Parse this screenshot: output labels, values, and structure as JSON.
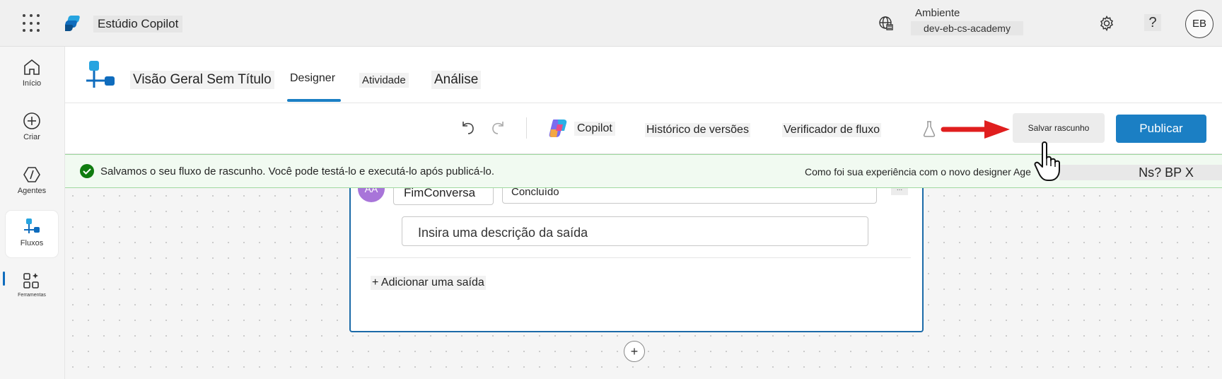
{
  "topbar": {
    "app_name": "Estúdio Copilot",
    "environment_label": "Ambiente",
    "environment_value": "dev-eb-cs-academy",
    "help_label": "?",
    "avatar_initials": "EB"
  },
  "rail": {
    "items": [
      {
        "label": "Início",
        "icon": "home-icon"
      },
      {
        "label": "Criar",
        "icon": "add-circle-icon"
      },
      {
        "label": "Agentes",
        "icon": "agents-icon"
      },
      {
        "label": "Fluxos",
        "icon": "flows-icon",
        "active": true
      },
      {
        "label": "Ferramentas",
        "icon": "tools-icon"
      }
    ],
    "more_label": "..."
  },
  "header": {
    "flow_title": "Visão Geral Sem Título",
    "tabs": [
      {
        "label": "Designer",
        "active": true
      },
      {
        "label": "Atividade"
      },
      {
        "label": "Análise"
      }
    ]
  },
  "toolbar": {
    "copilot_label": "Copilot",
    "history_label": "Histórico de versões",
    "checker_label": "Verificador de fluxo",
    "save_label": "Salvar rascunho",
    "publish_label": "Publicar"
  },
  "banner": {
    "message": "Salvamos o seu fluxo de rascunho. Você pode testá-lo e executá-lo após publicá-lo.",
    "feedback_prompt": "Como foi sua experiência com o novo designer Age",
    "feedback_controls": "Ns? BP X"
  },
  "output_card": {
    "avatar_initials": "AA",
    "output_name": "FimConversa",
    "output_value": "Concluído",
    "more_label": "...",
    "description_placeholder": "Insira uma descrição da saída",
    "add_output_label": "+ Adicionar uma saída"
  },
  "canvas": {
    "add_node_label": "+"
  },
  "colors": {
    "accent": "#1b7fc4",
    "success": "#107c10",
    "annotation_arrow": "#e01e1e",
    "avatar_purple": "#a875d9"
  }
}
